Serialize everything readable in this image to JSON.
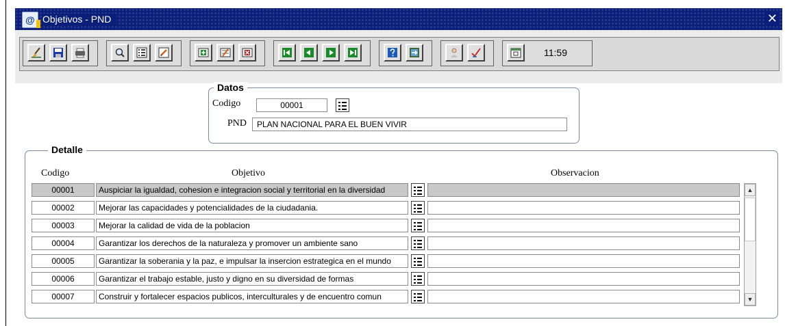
{
  "window": {
    "title": "Objetivos - PND",
    "icon": "app-icon",
    "close_glyph": "✕"
  },
  "toolbar": {
    "clock": "11:59",
    "buttons": [
      "clear-icon",
      "save-icon",
      "print-icon",
      "query-icon",
      "list-icon",
      "edit-icon",
      "insert-record-icon",
      "duplicate-record-icon",
      "delete-record-icon",
      "first-record-icon",
      "previous-record-icon",
      "next-record-icon",
      "last-record-icon",
      "help-icon",
      "exit-icon",
      "user-icon",
      "check-icon",
      "calendar-icon"
    ]
  },
  "datos": {
    "legend": "Datos",
    "codigo_label": "Codigo",
    "codigo_value": "00001",
    "pnd_label": "PND",
    "pnd_value": "PLAN NACIONAL PARA EL  BUEN VIVIR"
  },
  "detalle": {
    "legend": "Detalle",
    "headers": {
      "codigo": "Codigo",
      "objetivo": "Objetivo",
      "observacion": "Observacion"
    },
    "rows": [
      {
        "codigo": "00001",
        "objetivo": "Auspiciar la igualdad, cohesion e integracion social y territorial en la diversidad",
        "observacion": "",
        "selected": true
      },
      {
        "codigo": "00002",
        "objetivo": "Mejorar las capacidades y potencialidades de la ciudadania.",
        "observacion": ""
      },
      {
        "codigo": "00003",
        "objetivo": "Mejorar  la calidad de vida de la poblacion",
        "observacion": ""
      },
      {
        "codigo": "00004",
        "objetivo": "Garantizar los derechos de la naturaleza y promover un ambiente sano",
        "observacion": ""
      },
      {
        "codigo": "00005",
        "objetivo": "Garantizar la soberania y la paz, e impulsar la insercion estrategica en el mundo",
        "observacion": ""
      },
      {
        "codigo": "00006",
        "objetivo": "Garantizar el trabajo estable, justo y digno en su diversidad de formas",
        "observacion": ""
      },
      {
        "codigo": "00007",
        "objetivo": "Construir y fortalecer espacios publicos, interculturales y de encuentro comun",
        "observacion": ""
      }
    ]
  },
  "colors": {
    "titlebar": "#0a1e7a",
    "selected_row": "#c8c8c8",
    "toolbar_bg": "#d9d9d9"
  }
}
